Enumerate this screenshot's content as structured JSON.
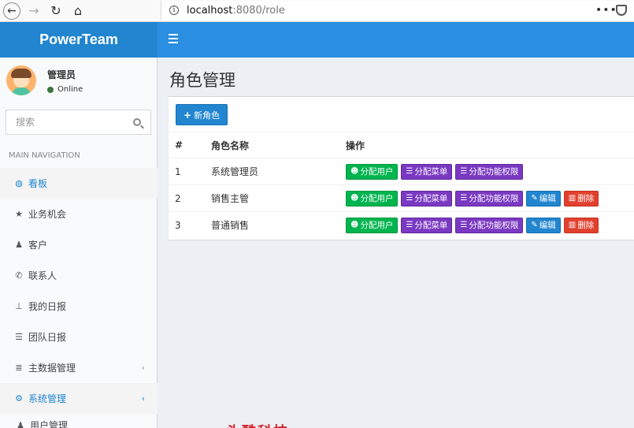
{
  "browser": {
    "url_host": "localhost",
    "url_path": ":8080/role",
    "menu_dots": "•••"
  },
  "app": {
    "brand": "PowerTeam"
  },
  "user": {
    "name": "管理员",
    "status": "Online"
  },
  "sidebar": {
    "search_placeholder": "搜索",
    "nav_header": "MAIN NAVIGATION",
    "items": [
      {
        "label": "看板",
        "icon": "dashboard-icon"
      },
      {
        "label": "业务机会",
        "icon": "star-icon"
      },
      {
        "label": "客户",
        "icon": "user-icon"
      },
      {
        "label": "联系人",
        "icon": "phone-icon"
      },
      {
        "label": "我的日报",
        "icon": "pin-icon"
      },
      {
        "label": "团队日报",
        "icon": "list-icon"
      },
      {
        "label": "主数据管理",
        "icon": "database-icon"
      },
      {
        "label": "系统管理",
        "icon": "gears-icon"
      }
    ],
    "sub_items": [
      {
        "label": "用户管理",
        "icon": "user-icon"
      }
    ]
  },
  "page": {
    "title": "角色管理",
    "new_button": "新角色"
  },
  "table": {
    "headers": [
      "#",
      "角色名称",
      "操作"
    ],
    "rows": [
      {
        "id": "1",
        "name": "系统管理员"
      },
      {
        "id": "2",
        "name": "销售主管"
      },
      {
        "id": "3",
        "name": "普通销售"
      }
    ],
    "actions": {
      "assign_users": "分配用户",
      "assign_menu": "分配菜单",
      "assign_perms": "分配功能权限",
      "edit": "编辑",
      "delete": "删除"
    }
  },
  "watermark": "头酷科技",
  "colors": {
    "brand": "#2185d0",
    "green": "#00b44e",
    "purple": "#7a39c2",
    "red": "#e2402e"
  }
}
